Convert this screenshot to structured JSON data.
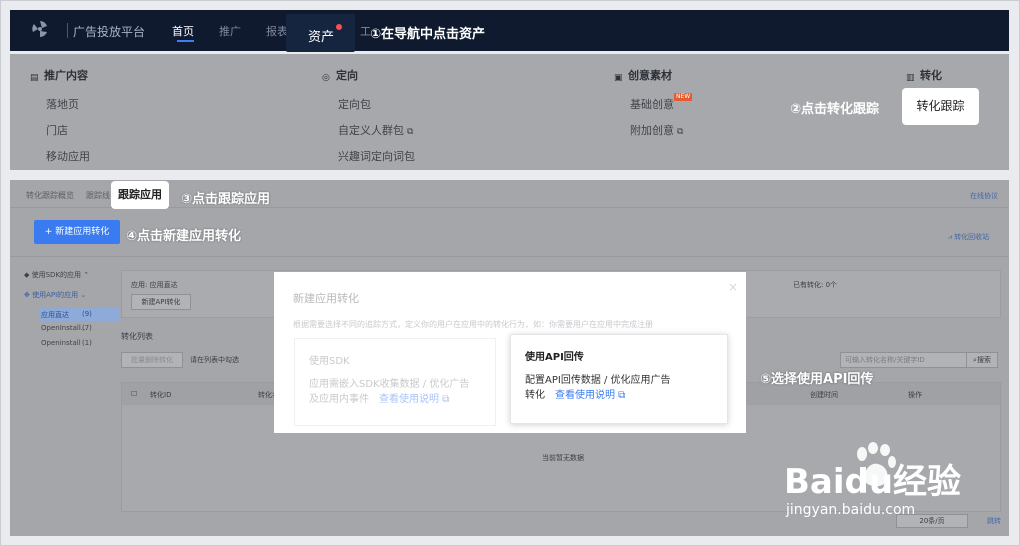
{
  "nav": {
    "brand": "广告投放平台",
    "items": [
      "首页",
      "推广",
      "报表"
    ],
    "truncated_item": "工",
    "asset": "资产"
  },
  "notes": {
    "n1": "①在导航中点击资产",
    "n2": "②点击转化跟踪",
    "n3": "③点击跟踪应用",
    "n4": "④点击新建应用转化",
    "n5": "⑤选择使用API回传"
  },
  "menu": {
    "col1": {
      "title": "推广内容",
      "items": [
        "落地页",
        "门店",
        "移动应用"
      ]
    },
    "col2": {
      "title": "定向",
      "items": [
        "定向包",
        "自定义人群包",
        "兴趣词定向词包"
      ]
    },
    "col3": {
      "title": "创意素材",
      "items": [
        "基础创意",
        "附加创意"
      ],
      "new_tag": "NEW"
    },
    "col4": {
      "title": "转化"
    },
    "track_button": "转化跟踪"
  },
  "page": {
    "tabs": [
      "转化跟踪概览",
      "跟踪线"
    ],
    "active_tab": "跟踪应用",
    "top_right_link": "在线协议",
    "new_button": "+ 新建应用转化",
    "right_link2": "转化回收站",
    "left_nav": {
      "sdk": "使用SDK的应用",
      "api": "使用API的应用",
      "items": [
        {
          "label": "应用直达",
          "count": "(9)"
        },
        {
          "label": "OpenInstall...",
          "count": "(7)"
        },
        {
          "label": "Openinstall",
          "count": "(1)"
        }
      ]
    },
    "app_label": "应用: 应用直达",
    "new_api_button": "新建API转化",
    "converted": "已有转化: 0个",
    "list_title": "转化列表",
    "batch_btn": "批量删除转化",
    "select_placeholder": "请在列表中勾选",
    "search_placeholder": "可输入转化名称/关键字ID",
    "search_btn": "搜索",
    "columns": [
      "转化ID",
      "转化名",
      "创建时间",
      "操作"
    ],
    "empty": "当前暂无数据",
    "footer_right": "跳转",
    "pager": "20条/页"
  },
  "modal": {
    "title": "新建应用转化",
    "desc": "根据需要选择不同的追踪方式，定义你的用户在应用中的转化行为，如：你需要用户在应用中完成注册",
    "sdk": {
      "title": "使用SDK",
      "line1": "应用需嵌入SDK收集数据 / 优化广告",
      "line2": "及应用内事件",
      "link": "查看使用说明"
    },
    "api": {
      "title": "使用API回传",
      "line1": "配置API回传数据 / 优化应用广告",
      "line2": "转化",
      "link": "查看使用说明"
    }
  },
  "watermark": {
    "brand": "Baidu经验",
    "url": "jingyan.baidu.com"
  }
}
